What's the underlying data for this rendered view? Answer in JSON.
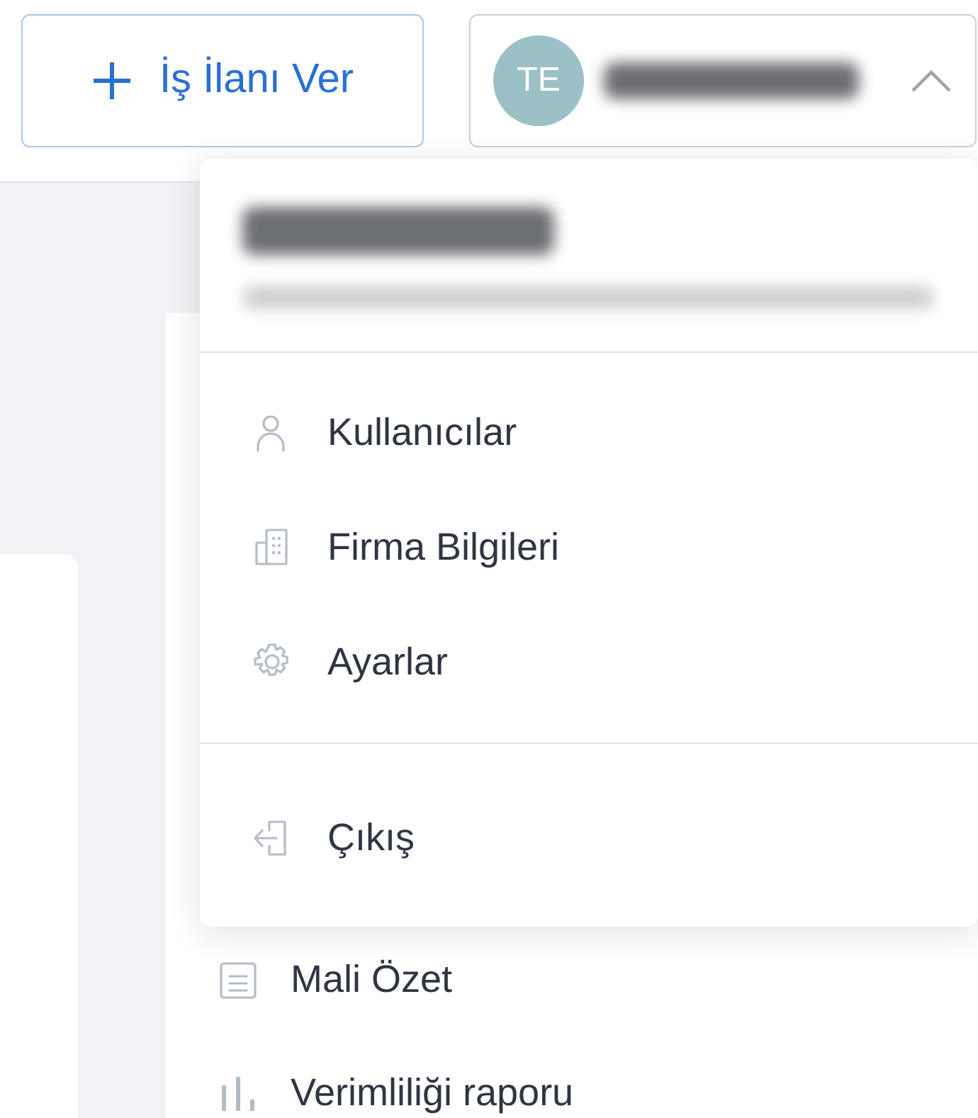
{
  "header": {
    "post_job_button": {
      "label": "İş İlanı Ver"
    },
    "account_button": {
      "initials": "TE",
      "expanded": true
    }
  },
  "sidebar": {
    "items": [
      {
        "label": "Mali Özet"
      },
      {
        "label": "Verimliliği raporu"
      }
    ]
  },
  "account_menu": {
    "groups": [
      [
        {
          "label": "Kullanıcılar"
        },
        {
          "label": "Firma Bilgileri"
        },
        {
          "label": "Ayarlar"
        }
      ],
      [
        {
          "label": "Çıkış"
        }
      ]
    ]
  }
}
